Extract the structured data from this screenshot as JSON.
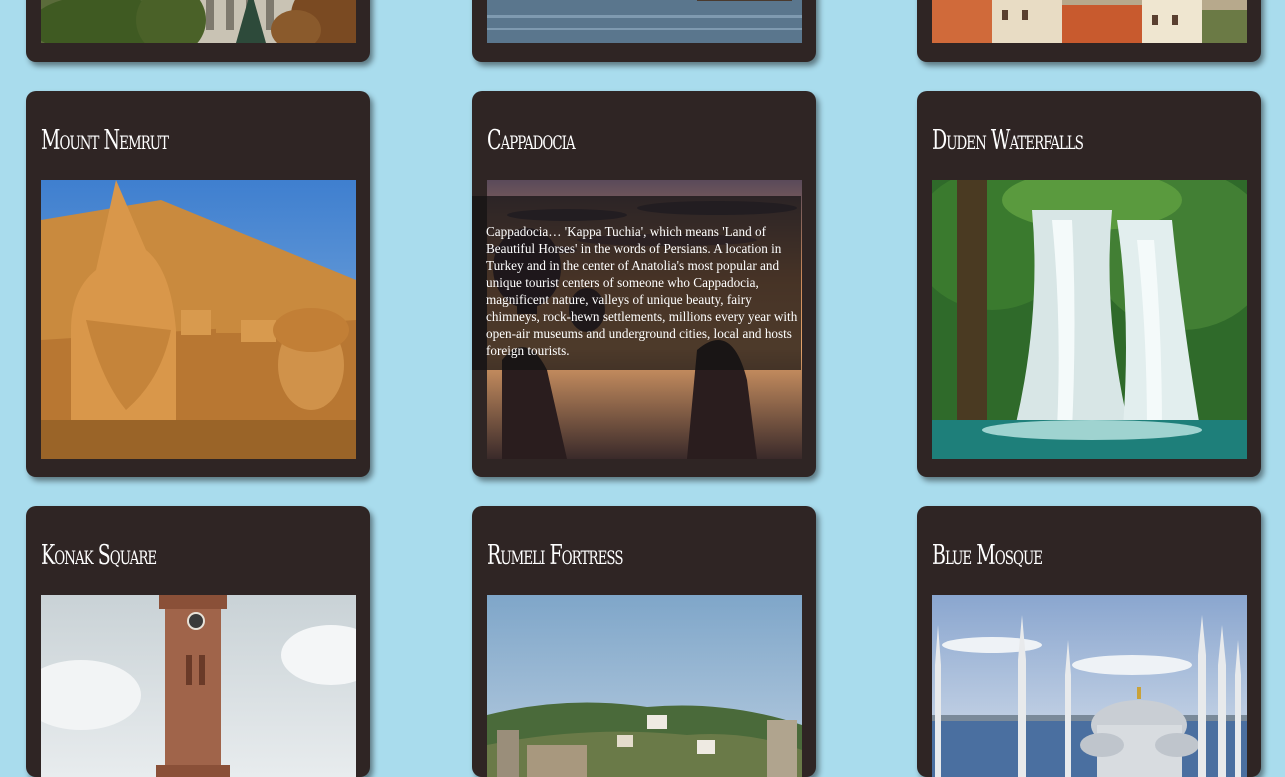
{
  "cards": [
    {
      "title": "",
      "image": "istanbul-gardens-photo"
    },
    {
      "title": "",
      "image": "bosphorus-water-photo"
    },
    {
      "title": "",
      "image": "safranbolu-houses-photo"
    },
    {
      "title": "Mount Nemrut",
      "image": "mount-nemrut-photo"
    },
    {
      "title": "Cappadocia",
      "image": "cappadocia-balloon-photo",
      "description": "Cappadocia… 'Kappa Tuchia', which means 'Land of Beautiful Horses' in the words of Persians. A location in Turkey and in the center of Anatolia's most popular and unique tourist centers of someone who Cappadocia, magnificent nature, valleys of unique beauty, fairy chimneys, rock-hewn settlements, millions every year with open-air museums and underground cities, local and hosts foreign tourists."
    },
    {
      "title": "Duden Waterfalls",
      "image": "duden-waterfalls-photo"
    },
    {
      "title": "Konak Square",
      "image": "konak-clock-tower-photo"
    },
    {
      "title": "Rumeli Fortress",
      "image": "rumeli-fortress-photo"
    },
    {
      "title": "Blue Mosque",
      "image": "blue-mosque-photo"
    }
  ],
  "colors": {
    "background": "#a9dced",
    "card": "#2f2524",
    "title": "#ffffff"
  }
}
